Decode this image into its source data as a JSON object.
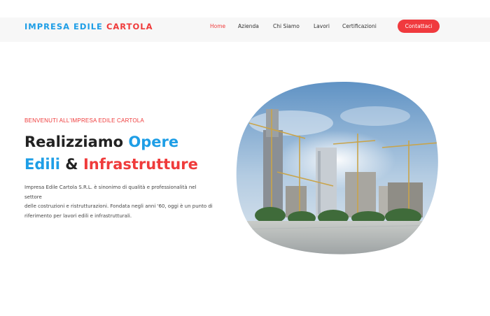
{
  "header": {
    "logo_part1": "IMPRESA EDILE",
    "logo_part2": "CARTOLA",
    "nav": [
      {
        "label": "Home",
        "active": true
      },
      {
        "label": "Azienda",
        "active": false
      },
      {
        "label": "Chi Siamo",
        "active": false
      },
      {
        "label": "Lavori",
        "active": false
      },
      {
        "label": "Certificazioni",
        "active": false
      }
    ],
    "cta_label": "Contattaci"
  },
  "hero": {
    "eyebrow": "BENVENUTI ALL'IMPRESA EDILE CARTOLA",
    "headline": {
      "w1": "Realizziamo",
      "w2": "Opere",
      "w3": "Edili",
      "w4": "&",
      "w5": "Infrastrutture"
    },
    "description_line1": "Impresa Edile Cartola S.R.L. è sinonimo di qualità e professionalità nel settore",
    "description_line2": "delle costruzioni e ristrutturazioni. Fondata negli anni '60, oggi è un punto di",
    "description_line3": "riferimento per lavori edili e infrastrutturali."
  },
  "colors": {
    "accent_blue": "#1e9ee6",
    "accent_red": "#ef3b3b"
  }
}
